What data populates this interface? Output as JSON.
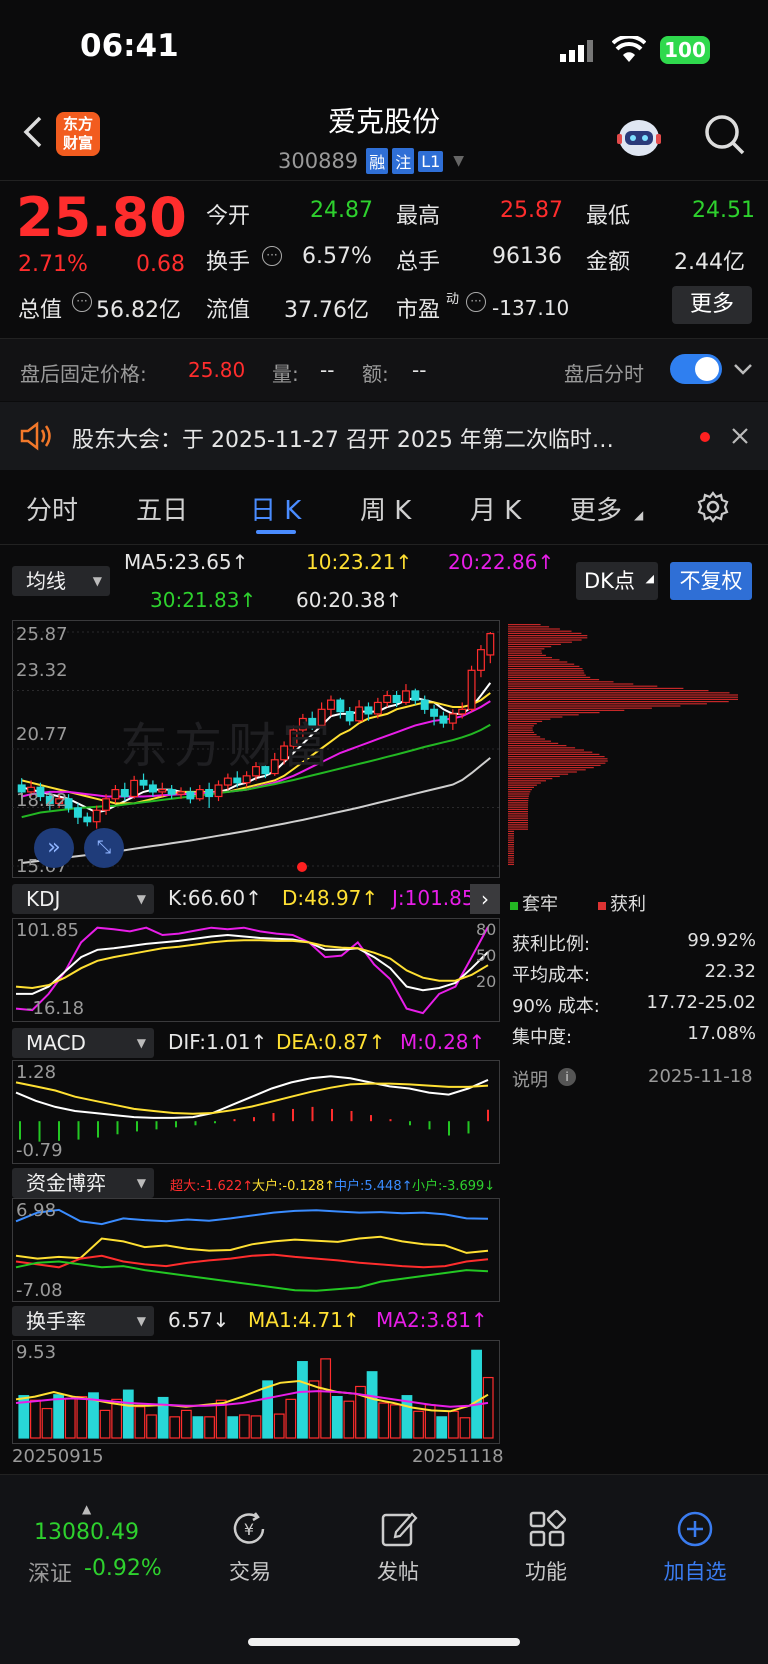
{
  "status_bar": {
    "time": "06:41",
    "battery": "100"
  },
  "header": {
    "logo": "东方财富",
    "title": "爱克股份",
    "code": "300889",
    "badges": [
      "融",
      "注",
      "L1"
    ]
  },
  "quote": {
    "price": "25.80",
    "change_pct": "2.71%",
    "change": "0.68",
    "rows": [
      [
        {
          "label": "今开",
          "value": "24.87",
          "color": "green"
        },
        {
          "label": "最高",
          "value": "25.87",
          "color": "red"
        },
        {
          "label": "最低",
          "value": "24.51",
          "color": "green"
        }
      ],
      [
        {
          "label": "换手",
          "value": "6.57%",
          "color": "white"
        },
        {
          "label": "总手",
          "value": "96136",
          "color": "white"
        },
        {
          "label": "金额",
          "value": "2.44亿",
          "color": "white"
        }
      ]
    ],
    "row3": {
      "total_mv_label": "总值",
      "total_mv": "56.82亿",
      "float_label": "流值",
      "float_mv": "37.76亿",
      "pe_label": "市盈",
      "pe_sup": "动",
      "pe": "-137.10"
    },
    "more_button": "更多"
  },
  "after_hours": {
    "label": "盘后固定价格:",
    "price": "25.80",
    "vol_label": "量:",
    "vol": "--",
    "amt_label": "额:",
    "amt": "--",
    "toggle_label": "盘后分时",
    "toggle_on": true
  },
  "notice": {
    "text": "股东大会：于 2025-11-27 召开 2025 年第二次临时…"
  },
  "tabs": {
    "items": [
      "分时",
      "五日",
      "日 K",
      "周 K",
      "月 K",
      "更多"
    ],
    "active": 2
  },
  "ma_bar": {
    "selector": "均线",
    "ma5": "MA5:23.65↑",
    "ma10": "10:23.21↑",
    "ma20": "20:22.86↑",
    "ma30": "30:21.83↑",
    "ma60": "60:20.38↑",
    "dk_button": "DK点",
    "adjust_button": "不复权"
  },
  "chart_data": {
    "type": "candlestick",
    "price_axis": [
      "25.87",
      "23.32",
      "20.77",
      "18.22",
      "15.67"
    ],
    "ylim": [
      15.67,
      25.87
    ],
    "candles": [
      [
        19.2,
        18.9,
        19.5,
        18.6
      ],
      [
        18.9,
        19.1,
        19.4,
        18.7
      ],
      [
        19.1,
        18.7,
        19.3,
        18.5
      ],
      [
        18.7,
        18.4,
        18.9,
        18.1
      ],
      [
        18.4,
        18.6,
        18.8,
        18.2
      ],
      [
        18.6,
        18.2,
        18.8,
        18.0
      ],
      [
        18.2,
        17.8,
        18.4,
        17.5
      ],
      [
        17.8,
        17.6,
        18.0,
        17.4
      ],
      [
        17.6,
        18.1,
        18.3,
        17.3
      ],
      [
        18.1,
        18.6,
        18.8,
        17.9
      ],
      [
        18.6,
        19.0,
        19.2,
        18.4
      ],
      [
        19.0,
        18.7,
        19.3,
        18.5
      ],
      [
        18.7,
        19.4,
        19.6,
        18.6
      ],
      [
        19.4,
        19.2,
        19.7,
        19.0
      ],
      [
        19.2,
        18.9,
        19.4,
        18.7
      ],
      [
        18.9,
        19.0,
        19.3,
        18.7
      ],
      [
        19.0,
        18.8,
        19.2,
        18.6
      ],
      [
        18.8,
        18.9,
        19.1,
        18.6
      ],
      [
        18.9,
        18.6,
        19.1,
        18.4
      ],
      [
        18.6,
        19.0,
        19.2,
        18.5
      ],
      [
        19.0,
        18.7,
        19.3,
        18.2
      ],
      [
        18.7,
        19.2,
        19.4,
        18.5
      ],
      [
        19.2,
        19.5,
        19.7,
        19.0
      ],
      [
        19.5,
        19.3,
        19.8,
        19.1
      ],
      [
        19.3,
        19.6,
        19.8,
        19.1
      ],
      [
        19.6,
        20.0,
        20.2,
        19.4
      ],
      [
        20.0,
        19.7,
        20.3,
        19.5
      ],
      [
        19.7,
        20.3,
        20.6,
        19.6
      ],
      [
        20.3,
        20.9,
        21.1,
        20.1
      ],
      [
        20.9,
        21.6,
        21.8,
        20.7
      ],
      [
        21.6,
        22.1,
        22.3,
        21.3
      ],
      [
        22.1,
        21.8,
        22.4,
        21.6
      ],
      [
        21.8,
        22.5,
        22.8,
        21.7
      ],
      [
        22.5,
        22.9,
        23.1,
        22.2
      ],
      [
        22.9,
        22.4,
        23.0,
        22.1
      ],
      [
        22.4,
        22.0,
        22.6,
        21.8
      ],
      [
        22.0,
        22.6,
        22.9,
        21.9
      ],
      [
        22.6,
        22.3,
        22.8,
        22.0
      ],
      [
        22.3,
        22.8,
        23.0,
        22.1
      ],
      [
        22.8,
        23.1,
        23.3,
        22.6
      ],
      [
        23.1,
        22.8,
        23.3,
        22.6
      ],
      [
        22.8,
        23.3,
        23.6,
        22.7
      ],
      [
        23.3,
        22.9,
        23.4,
        22.7
      ],
      [
        22.9,
        22.5,
        23.1,
        22.3
      ],
      [
        22.5,
        22.2,
        22.7,
        21.8
      ],
      [
        22.2,
        21.9,
        22.4,
        21.7
      ],
      [
        21.9,
        22.3,
        22.5,
        21.6
      ],
      [
        22.3,
        22.5,
        22.8,
        22.1
      ],
      [
        22.5,
        24.2,
        24.4,
        22.4
      ],
      [
        24.2,
        25.1,
        25.3,
        23.9
      ],
      [
        24.87,
        25.8,
        25.87,
        24.51
      ]
    ],
    "ma_lines": [
      {
        "name": "MA5",
        "color": "#ffffff",
        "values": [
          19.1,
          19.0,
          18.9,
          18.8,
          18.7,
          18.6,
          18.4,
          18.2,
          18.0,
          18.1,
          18.3,
          18.5,
          18.7,
          18.9,
          19.0,
          19.0,
          19.0,
          18.9,
          18.8,
          18.8,
          18.8,
          18.9,
          19.0,
          19.2,
          19.3,
          19.5,
          19.6,
          19.8,
          20.2,
          20.6,
          21.0,
          21.4,
          21.8,
          22.2,
          22.3,
          22.3,
          22.4,
          22.4,
          22.4,
          22.6,
          22.7,
          22.9,
          23.0,
          22.9,
          22.8,
          22.5,
          22.3,
          22.3,
          22.6,
          23.1,
          23.65
        ]
      },
      {
        "name": "MA10",
        "color": "#ffe033",
        "values": [
          19.4,
          19.3,
          19.2,
          19.1,
          19.0,
          18.9,
          18.8,
          18.7,
          18.6,
          18.5,
          18.4,
          18.4,
          18.4,
          18.5,
          18.6,
          18.7,
          18.8,
          18.9,
          18.9,
          18.9,
          18.9,
          18.9,
          18.9,
          19.0,
          19.1,
          19.2,
          19.3,
          19.4,
          19.6,
          19.9,
          20.2,
          20.5,
          20.8,
          21.1,
          21.4,
          21.6,
          21.9,
          22.1,
          22.2,
          22.3,
          22.5,
          22.6,
          22.7,
          22.8,
          22.8,
          22.7,
          22.6,
          22.6,
          22.7,
          22.9,
          23.21
        ]
      },
      {
        "name": "MA20",
        "color": "#e81ee8",
        "values": [
          18.7,
          18.8,
          18.85,
          18.9,
          18.9,
          18.9,
          18.85,
          18.8,
          18.75,
          18.7,
          18.7,
          18.7,
          18.7,
          18.7,
          18.72,
          18.75,
          18.78,
          18.8,
          18.82,
          18.84,
          18.86,
          18.88,
          18.9,
          18.95,
          19.0,
          19.1,
          19.2,
          19.3,
          19.45,
          19.6,
          19.8,
          20.0,
          20.2,
          20.4,
          20.6,
          20.75,
          20.9,
          21.05,
          21.2,
          21.35,
          21.5,
          21.65,
          21.8,
          21.9,
          22.0,
          22.05,
          22.1,
          22.2,
          22.4,
          22.6,
          22.86
        ]
      },
      {
        "name": "MA30",
        "color": "#23b723",
        "values": [
          17.8,
          17.9,
          18.0,
          18.05,
          18.1,
          18.15,
          18.2,
          18.22,
          18.25,
          18.28,
          18.3,
          18.35,
          18.4,
          18.45,
          18.5,
          18.55,
          18.6,
          18.65,
          18.7,
          18.75,
          18.8,
          18.85,
          18.9,
          18.95,
          19.0,
          19.08,
          19.16,
          19.24,
          19.33,
          19.42,
          19.52,
          19.62,
          19.72,
          19.82,
          19.92,
          20.02,
          20.12,
          20.22,
          20.32,
          20.43,
          20.53,
          20.64,
          20.75,
          20.86,
          20.96,
          21.06,
          21.16,
          21.28,
          21.42,
          21.6,
          21.83
        ]
      },
      {
        "name": "MA60",
        "color": "#cfcfcf",
        "values": [
          15.8,
          15.85,
          15.9,
          15.95,
          16.0,
          16.05,
          16.1,
          16.15,
          16.2,
          16.25,
          16.3,
          16.36,
          16.42,
          16.48,
          16.54,
          16.6,
          16.66,
          16.72,
          16.78,
          16.85,
          16.92,
          16.99,
          17.06,
          17.13,
          17.2,
          17.28,
          17.36,
          17.44,
          17.52,
          17.6,
          17.68,
          17.77,
          17.86,
          17.95,
          18.04,
          18.13,
          18.22,
          18.32,
          18.42,
          18.52,
          18.62,
          18.72,
          18.82,
          18.92,
          19.02,
          19.12,
          19.22,
          19.42,
          19.72,
          20.05,
          20.38
        ]
      }
    ],
    "chip_legend": {
      "trapped": "套牢",
      "profit": "获利"
    },
    "chip_stats": [
      {
        "label": "获利比例:",
        "value": "99.92%"
      },
      {
        "label": "平均成本:",
        "value": "22.32"
      },
      {
        "label": "90% 成本:",
        "value": "17.72-25.02"
      },
      {
        "label": "集中度:",
        "value": "17.08%"
      }
    ],
    "chip_note": {
      "label": "说明",
      "date": "2025-11-18"
    },
    "kdj": {
      "selector": "KDJ",
      "k": "K:66.60↑",
      "d": "D:48.97↑",
      "j": "J:101.85↑",
      "axis_top": "101.85",
      "axis_bottom": "-16.18",
      "right_ticks": [
        "80",
        "50",
        "20"
      ]
    },
    "macd": {
      "selector": "MACD",
      "dif": "DIF:1.01↑",
      "dea": "DEA:0.87↑",
      "m": "M:0.28↑",
      "axis_top": "1.28",
      "axis_bottom": "-0.79"
    },
    "fund": {
      "selector": "资金博弈",
      "super": "超大:-1.622↑",
      "big": "大户:-0.128↑",
      "mid": "中户:5.448↑",
      "small": "小户:-3.699↓",
      "axis_top": "6.98",
      "axis_bottom": "-7.08"
    },
    "turnover": {
      "selector": "换手率",
      "value": "6.57↓",
      "ma1": "MA1:4.71↑",
      "ma2": "MA2:3.81↑",
      "axis_top": "9.53",
      "date_start": "20250915",
      "date_end": "20251118"
    }
  },
  "bottom_nav": {
    "index_value": "13080.49",
    "index_name": "深证",
    "index_change": "-0.92%",
    "items": [
      "交易",
      "发帖",
      "功能",
      "加自选"
    ]
  }
}
